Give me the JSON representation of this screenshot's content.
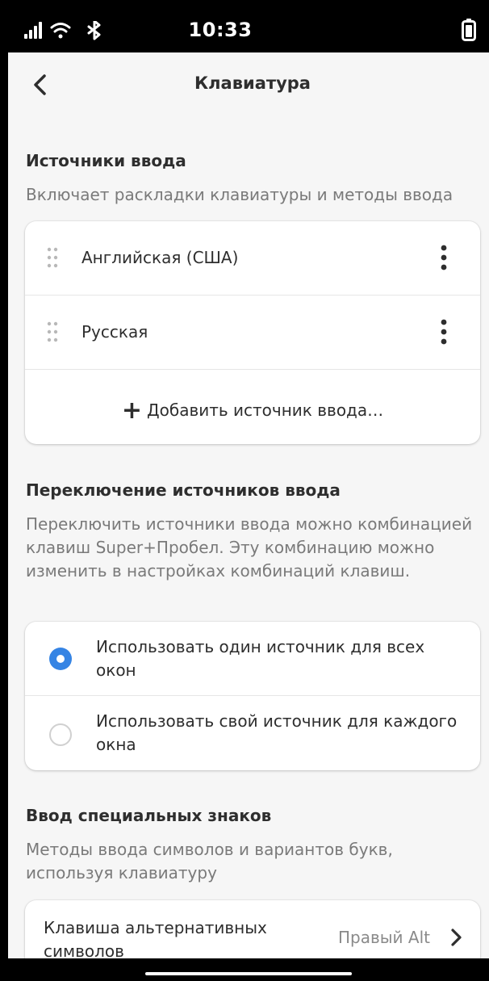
{
  "status_bar": {
    "time": "10:33",
    "icons": [
      "signal-icon",
      "wifi-icon",
      "bluetooth-icon",
      "battery-icon"
    ]
  },
  "header": {
    "title": "Клавиатура",
    "back_icon": "chevron-left-icon"
  },
  "input_sources": {
    "title": "Источники ввода",
    "description": "Включает раскладки клавиатуры и методы ввода",
    "items": [
      {
        "label": "Английская (США)"
      },
      {
        "label": "Русская"
      }
    ],
    "add_label": "Добавить источник ввода…",
    "add_symbol": "+"
  },
  "switching": {
    "title": "Переключение источников ввода",
    "description": "Переключить источники ввода можно комбинацией клавиш Super+Пробел. Эту комбинацию можно изменить в настройках комбинаций клавиш.",
    "options": [
      {
        "label": "Использовать один источник для всех окон",
        "selected": true
      },
      {
        "label": "Использовать свой источник для каждого окна",
        "selected": false
      }
    ]
  },
  "special_chars": {
    "title": "Ввод специальных знаков",
    "description": "Методы ввода символов и вариантов букв, используя клавиатуру",
    "alt_key_label": "Клавиша альтернативных символов",
    "alt_key_value": "Правый Alt"
  },
  "colors": {
    "accent": "#3584e4",
    "background": "#f6f6f6",
    "card": "#ffffff",
    "text": "#2e2e2e",
    "muted": "#7a7a7a"
  }
}
